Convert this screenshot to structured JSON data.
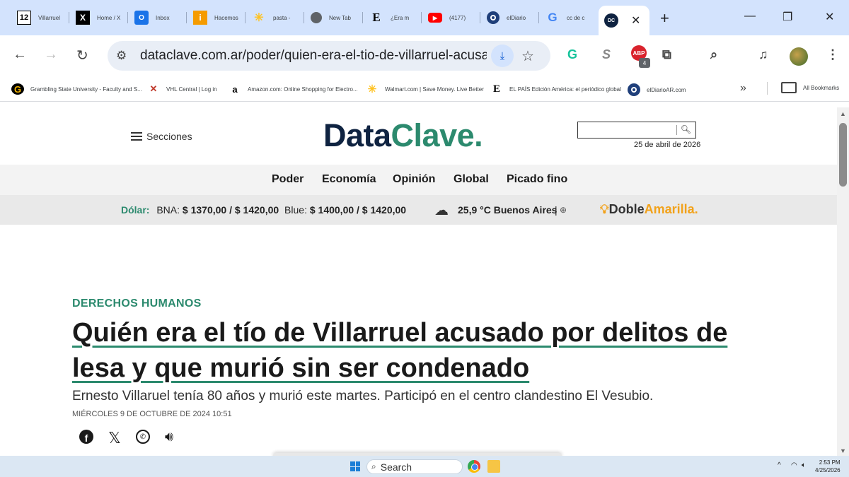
{
  "tabs": [
    {
      "title": "Villarruel",
      "favicon": "12"
    },
    {
      "title": "Home / X",
      "favicon": "X"
    },
    {
      "title": "Inbox",
      "favicon": "outlook-icon"
    },
    {
      "title": "Hacemos",
      "favicon": "i"
    },
    {
      "title": "pasta -",
      "favicon": "walmart-icon"
    },
    {
      "title": "New Tab",
      "favicon": "chrome-icon"
    },
    {
      "title": "¿Era m",
      "favicon": "E"
    },
    {
      "title": "(4177)",
      "favicon": "youtube-icon"
    },
    {
      "title": "elDiario",
      "favicon": "eldiario-icon"
    },
    {
      "title": "cc de c",
      "favicon": "G"
    },
    {
      "title": "",
      "favicon": "DC"
    }
  ],
  "toolbar": {
    "url": "dataclave.com.ar/poder/quien-era-el-tio-de-villarruel-acusa...",
    "abp_badge": "4"
  },
  "bookmarks": [
    {
      "label": "Grambling State University - Faculty and S...",
      "icon": "G"
    },
    {
      "label": "VHL Central | Log in",
      "icon": "vhl-icon"
    },
    {
      "label": "Amazon.com: Online Shopping for Electro...",
      "icon": "a"
    },
    {
      "label": "Walmart.com | Save Money. Live Better",
      "icon": "walmart-icon"
    },
    {
      "label": "EL PAÍS Edición América: el periódico global",
      "icon": "E"
    },
    {
      "label": "elDiarioAR.com",
      "icon": "eldiario-icon"
    }
  ],
  "all_bookmarks": "All Bookmarks",
  "site": {
    "secciones": "Secciones",
    "logo_dark": "Data",
    "logo_green": "Clave.",
    "date": "25 de abril de 2026",
    "nav": [
      "Poder",
      "Economía",
      "Opinión",
      "Global",
      "Picado fino"
    ],
    "dolar_label": "Dólar:",
    "bna_label": "BNA:",
    "bna_value": "$ 1370,00 / $ 1420,00",
    "blue_label": "Blue:",
    "blue_value": "$ 1400,00 / $ 1420,00",
    "weather": "25,9 °C Buenos Aires",
    "doble": "Doble",
    "amarilla": "Amarilla."
  },
  "article": {
    "category": "DERECHOS HUMANOS",
    "headline_1": "Quién era el tío de Villarruel acusado por delitos de",
    "headline_2": "lesa y que murió sin ser condenado",
    "subtitle": "Ernesto Villaruel tenía 80 años y murió este martes. Participó en el centro clandestino El Vesubio.",
    "published": "MIÉRCOLES 9 DE OCTUBRE DE 2024 10:51"
  },
  "taskbar": {
    "search": "Search",
    "time": "2:53 PM",
    "date": "4/25/2026"
  }
}
